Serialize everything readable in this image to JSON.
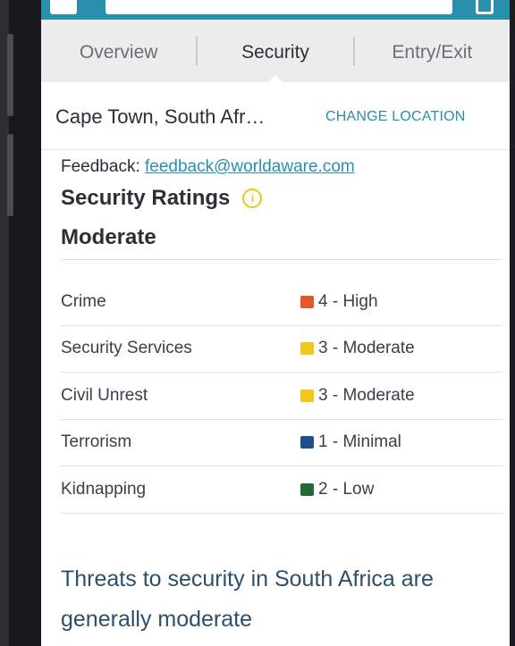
{
  "tabs": [
    {
      "label": "Overview",
      "active": false
    },
    {
      "label": "Security",
      "active": true
    },
    {
      "label": "Entry/Exit",
      "active": false
    }
  ],
  "location": {
    "name": "Cape Town, South Afr…",
    "change_label": "CHANGE LOCATION"
  },
  "feedback": {
    "prefix": "Feedback: ",
    "email": "feedback@worldaware.com"
  },
  "security": {
    "title": "Security Ratings",
    "info_icon": "info-icon",
    "overall": "Moderate",
    "ratings": [
      {
        "category": "Crime",
        "value": "4 - High",
        "color": "#e8562a"
      },
      {
        "category": "Security Services",
        "value": "3 - Moderate",
        "color": "#f5c518"
      },
      {
        "category": "Civil Unrest",
        "value": "3 - Moderate",
        "color": "#f5c518"
      },
      {
        "category": "Terrorism",
        "value": "1 - Minimal",
        "color": "#1f4e8c"
      },
      {
        "category": "Kidnapping",
        "value": "2 - Low",
        "color": "#1e6b35"
      }
    ]
  },
  "summary": "Threats to security in South Africa are generally moderate",
  "colors": {
    "accent": "#2a8fad",
    "tab_background": "#ececec"
  }
}
